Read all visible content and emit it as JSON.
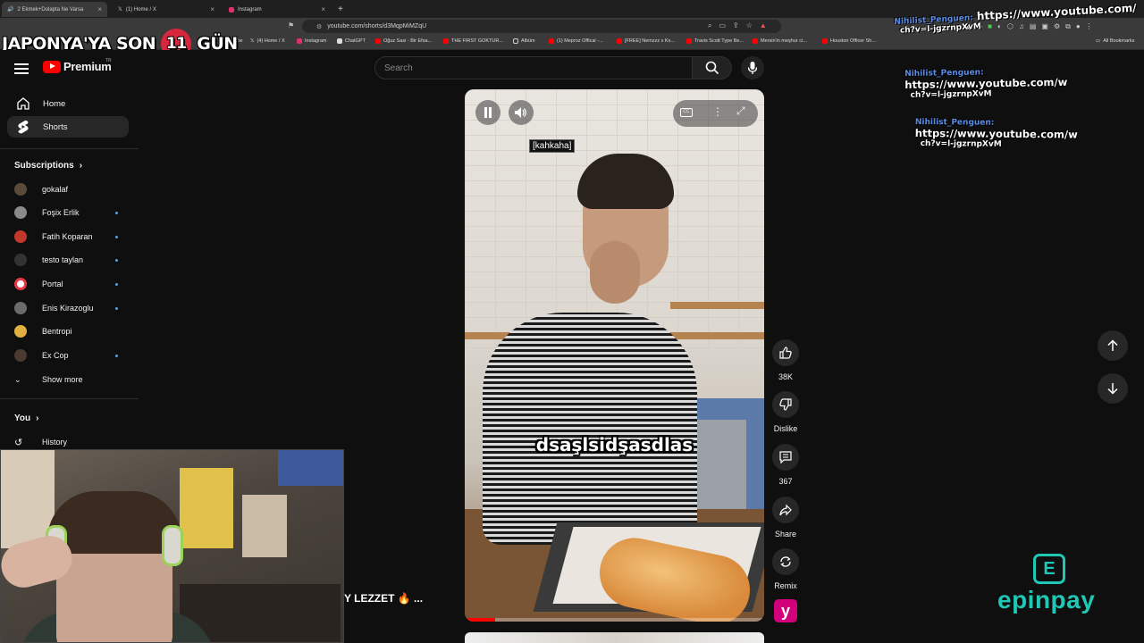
{
  "browser": {
    "tabs": [
      {
        "title": "2 Ekmek+Dolapta Ne Varsa",
        "active": true
      },
      {
        "title": "(1) Home / X",
        "active": false
      },
      {
        "title": "Instagram",
        "active": false
      }
    ],
    "new_tab": "+",
    "url": "youtube.com/shorts/d3MqpMiMZqU",
    "bookmarks": [
      "YouTube",
      "(4) Home / X",
      "Instagram",
      "ChatGPT",
      "Oğuz Sasi - Bir Efsa...",
      "THE FIRST GOKTUR...",
      "Albüm",
      "(1) Meproz Offical -...",
      "[FREE] Nemzzz x Ks...",
      "Travis Scott Type Be...",
      "Mersin'in meşhur ci...",
      "Houston Officer Sh..."
    ],
    "all_bookmarks": "All Bookmarks"
  },
  "overlay": {
    "countdown_prefix": "JAPONYA'YA SON",
    "countdown_number": "11",
    "countdown_suffix": "GÜN"
  },
  "header": {
    "logo_text": "Premium",
    "country": "TR",
    "search_placeholder": "Search"
  },
  "sidebar": {
    "nav": [
      {
        "label": "Home",
        "icon": "home-icon",
        "active": false
      },
      {
        "label": "Shorts",
        "icon": "shorts-icon",
        "active": true
      }
    ],
    "subscriptions_title": "Subscriptions",
    "subscriptions": [
      {
        "name": "gokalaf",
        "color": "#5a4a3a",
        "live": false
      },
      {
        "name": "Foşix Erlik",
        "color": "#8a8a8a",
        "live": true
      },
      {
        "name": "Fatih Koparan",
        "color": "#c0392b",
        "live": true
      },
      {
        "name": "testo taylan",
        "color": "#333333",
        "live": true
      },
      {
        "name": "Portal",
        "color": "#e63946",
        "live": true
      },
      {
        "name": "Enis Kirazoglu",
        "color": "#6b6b6b",
        "live": true
      },
      {
        "name": "Bentropi",
        "color": "#e0b040",
        "live": false
      },
      {
        "name": "Ex Cop",
        "color": "#4a3a30",
        "live": true
      }
    ],
    "show_more": "Show more",
    "you_title": "You",
    "history": "History"
  },
  "video": {
    "caption_top": "[kahkaha]",
    "caption_main": "dsaşlsidşasdlas",
    "progress": 0.1,
    "partial_title": "Y LEZZET 🔥 ..."
  },
  "actions": {
    "like_count": "38K",
    "dislike_label": "Dislike",
    "comment_count": "367",
    "share_label": "Share",
    "remix_label": "Remix",
    "channel_letter": "y"
  },
  "chat": [
    {
      "user": "Nihilist_Penguen:",
      "text": "https://www.youtube.com/",
      "text2": "ch?v=l-jgzrnpXvM"
    },
    {
      "user": "Nihilist_Penguen:",
      "text": "https://www.youtube.com/w",
      "text2": "ch?v=l-jgzrnpXvM"
    },
    {
      "user": "Nihilist_Penguen:",
      "text": "https://www.youtube.com/w",
      "text2": "ch?v=l-jgzrnpXvM"
    }
  ],
  "sponsor": {
    "logo_letter": "E",
    "name": "epinpay",
    "color": "#1ec8b4"
  }
}
